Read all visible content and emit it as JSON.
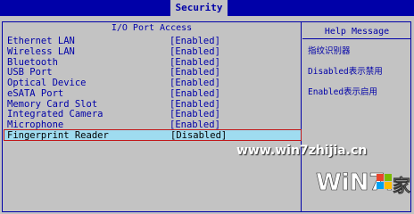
{
  "tabs": {
    "active": "Security"
  },
  "main": {
    "title": "I/O Port Access",
    "items": [
      {
        "label": "Ethernet LAN",
        "value": "[Enabled]"
      },
      {
        "label": "Wireless LAN",
        "value": "[Enabled]"
      },
      {
        "label": "Bluetooth",
        "value": "[Enabled]"
      },
      {
        "label": "USB Port",
        "value": "[Enabled]"
      },
      {
        "label": "Optical Device",
        "value": "[Enabled]"
      },
      {
        "label": "eSATA Port",
        "value": "[Enabled]"
      },
      {
        "label": "Memory Card Slot",
        "value": "[Enabled]"
      },
      {
        "label": "Integrated Camera",
        "value": "[Enabled]"
      },
      {
        "label": "Microphone",
        "value": "[Enabled]"
      },
      {
        "label": "Fingerprint Reader",
        "value": "[Disabled]"
      }
    ]
  },
  "help": {
    "title": "Help Message",
    "lines": [
      "指纹识别器",
      "Disabled表示禁用",
      "Enabled表示启用"
    ]
  },
  "watermark": {
    "url": "www.win7zhijia.cn",
    "logo_text": "WiN7.",
    "logo_suffix": "家"
  },
  "colors": {
    "bios_blue": "#0000a8",
    "panel_gray": "#c3c3c3",
    "highlight": "#9fdcf0",
    "selection_border": "#c0181a"
  }
}
